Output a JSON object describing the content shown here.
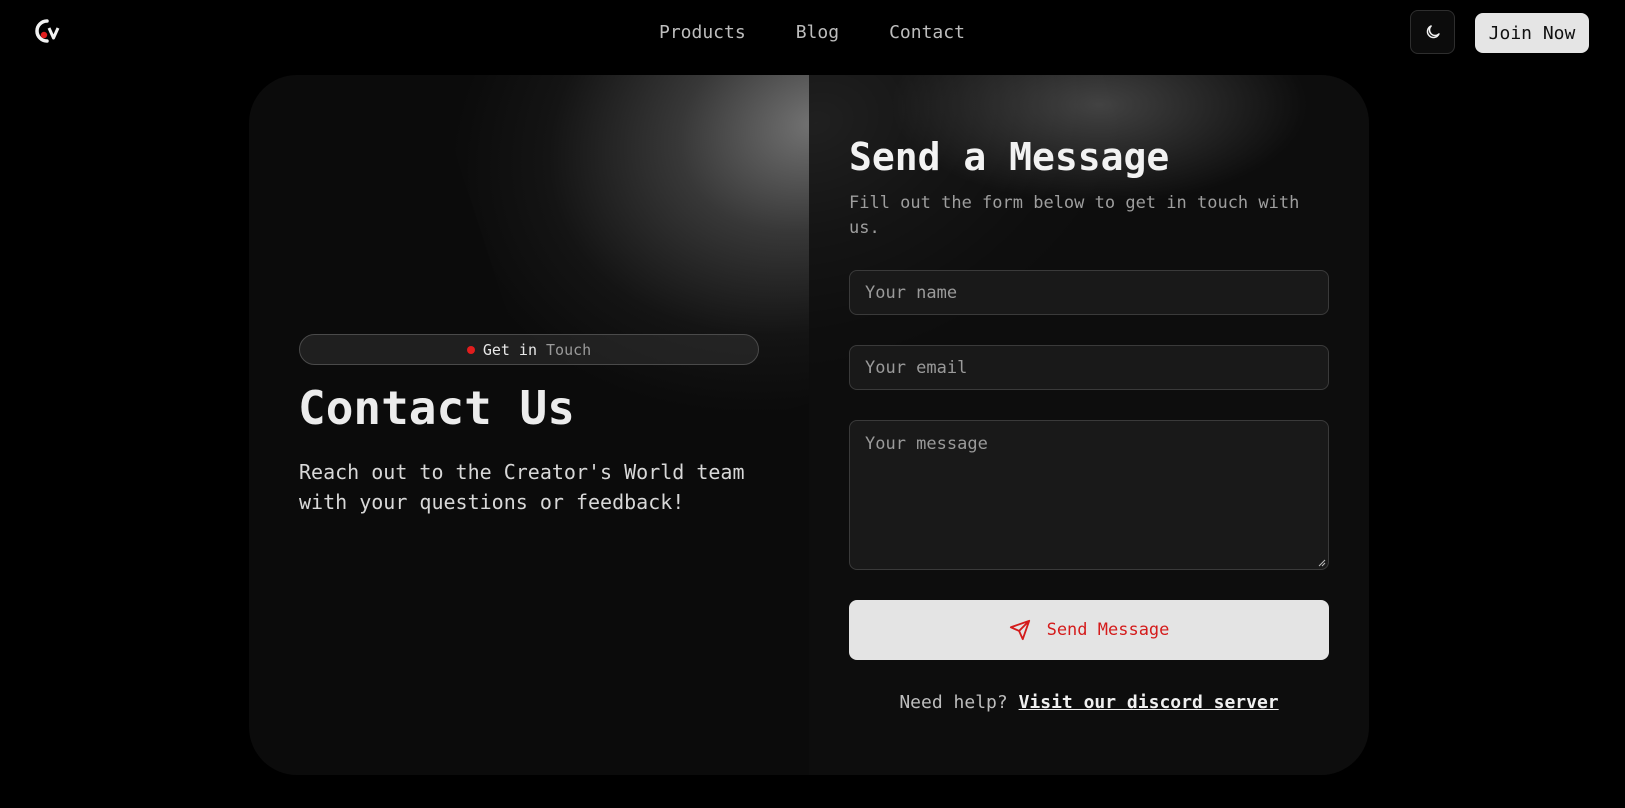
{
  "nav": {
    "links": [
      "Products",
      "Blog",
      "Contact"
    ],
    "join_label": "Join Now",
    "logo_icon": "creators-world-logo",
    "theme_icon": "moon-icon"
  },
  "hero": {
    "badge": {
      "part1": "Get in",
      "part2": "Touch"
    },
    "title": "Contact Us",
    "description": "Reach out to the Creator's World team with your questions or feedback!"
  },
  "form": {
    "title": "Send a Message",
    "subtitle": "Fill out the form below to get in touch with us.",
    "name_placeholder": "Your name",
    "email_placeholder": "Your email",
    "message_placeholder": "Your message",
    "send_label": "Send Message",
    "send_icon": "send-icon",
    "help_text": "Need help?",
    "help_link": "Visit our discord server"
  },
  "colors": {
    "accent": "#e11d1d",
    "background": "#000000",
    "card": "#0b0b0b",
    "button": "#e4e4e4"
  }
}
